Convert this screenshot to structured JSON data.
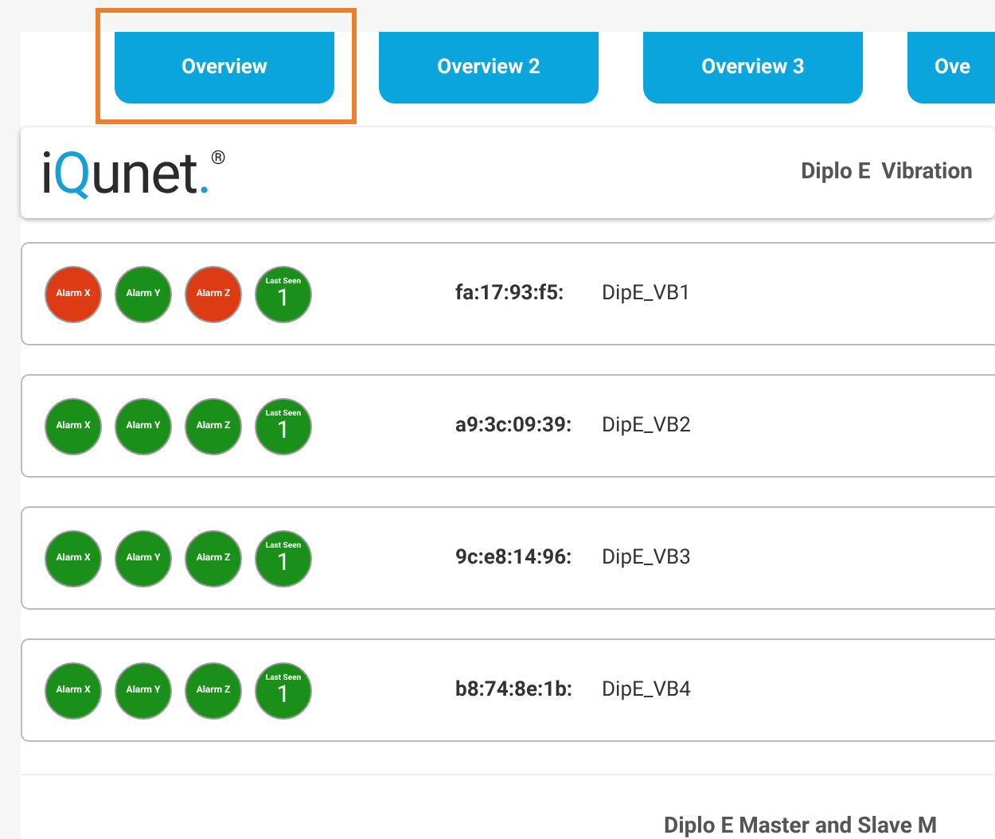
{
  "tabs": [
    {
      "label": "Overview",
      "highlighted": true
    },
    {
      "label": "Overview 2",
      "highlighted": false
    },
    {
      "label": "Overview 3",
      "highlighted": false
    },
    {
      "label": "Ove",
      "highlighted": false
    }
  ],
  "header": {
    "logo": {
      "brand_start": "i",
      "brand_q": "Q",
      "brand_end": "unet",
      "dot": ".",
      "mark": "®"
    },
    "title": "Diplo E  Vibration"
  },
  "devices": [
    {
      "alarms": [
        {
          "label": "Alarm X",
          "alarm": true
        },
        {
          "label": "Alarm Y",
          "alarm": false
        },
        {
          "label": "Alarm Z",
          "alarm": true
        }
      ],
      "last_seen": {
        "label": "Last Seen",
        "value": "1"
      },
      "mac": "fa:17:93:f5:",
      "name": "DipE_VB1"
    },
    {
      "alarms": [
        {
          "label": "Alarm X",
          "alarm": false
        },
        {
          "label": "Alarm Y",
          "alarm": false
        },
        {
          "label": "Alarm Z",
          "alarm": false
        }
      ],
      "last_seen": {
        "label": "Last Seen",
        "value": "1"
      },
      "mac": "a9:3c:09:39:",
      "name": "DipE_VB2"
    },
    {
      "alarms": [
        {
          "label": "Alarm X",
          "alarm": false
        },
        {
          "label": "Alarm Y",
          "alarm": false
        },
        {
          "label": "Alarm Z",
          "alarm": false
        }
      ],
      "last_seen": {
        "label": "Last Seen",
        "value": "1"
      },
      "mac": "9c:e8:14:96:",
      "name": "DipE_VB3"
    },
    {
      "alarms": [
        {
          "label": "Alarm X",
          "alarm": false
        },
        {
          "label": "Alarm Y",
          "alarm": false
        },
        {
          "label": "Alarm Z",
          "alarm": false
        }
      ],
      "last_seen": {
        "label": "Last Seen",
        "value": "1"
      },
      "mac": "b8:74:8e:1b:",
      "name": "DipE_VB4"
    }
  ],
  "footer_card": {
    "title": "Diplo E Master and Slave M"
  }
}
